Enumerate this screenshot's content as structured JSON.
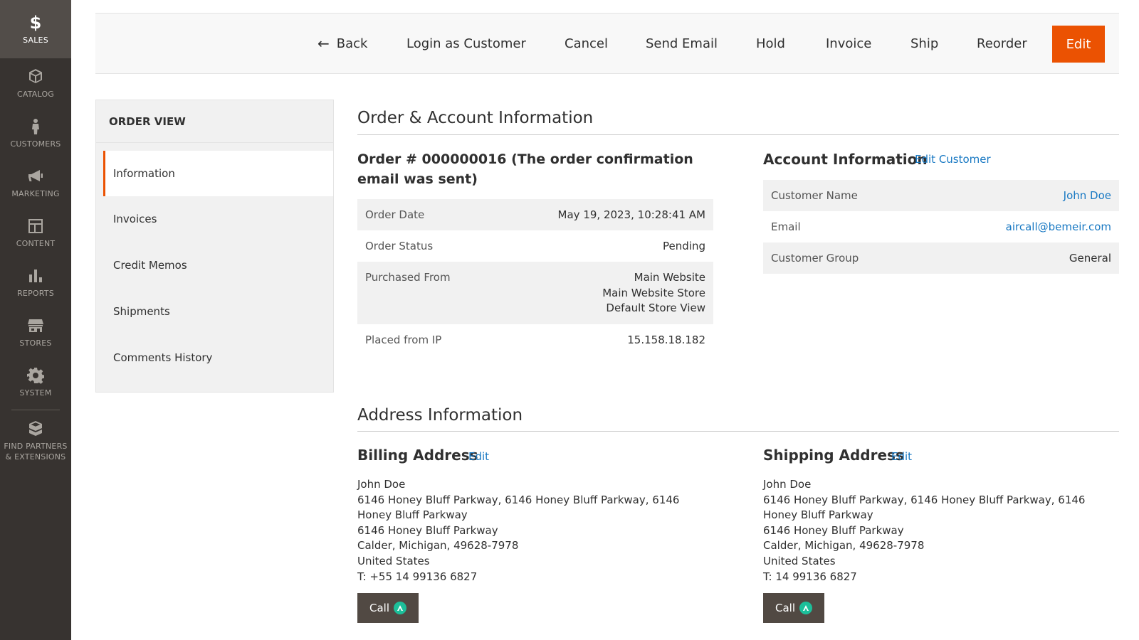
{
  "sidebar": {
    "items": [
      {
        "key": "sales",
        "label": "SALES",
        "icon": "dollar-icon",
        "active": true
      },
      {
        "key": "catalog",
        "label": "CATALOG",
        "icon": "cube-icon"
      },
      {
        "key": "customers",
        "label": "CUSTOMERS",
        "icon": "person-icon"
      },
      {
        "key": "marketing",
        "label": "MARKETING",
        "icon": "megaphone-icon"
      },
      {
        "key": "content",
        "label": "CONTENT",
        "icon": "layout-icon"
      },
      {
        "key": "reports",
        "label": "REPORTS",
        "icon": "bar-chart-icon"
      },
      {
        "key": "stores",
        "label": "STORES",
        "icon": "store-icon"
      },
      {
        "key": "system",
        "label": "SYSTEM",
        "icon": "gear-icon"
      },
      {
        "key": "partners",
        "label": "FIND PARTNERS\n& EXTENSIONS",
        "icon": "boxes-icon"
      }
    ]
  },
  "toolbar": {
    "back": "Back",
    "login_as_customer": "Login as Customer",
    "cancel": "Cancel",
    "send_email": "Send Email",
    "hold": "Hold",
    "invoice": "Invoice",
    "ship": "Ship",
    "reorder": "Reorder",
    "edit": "Edit",
    "accent_color": "#eb5202"
  },
  "order_view": {
    "title": "ORDER VIEW",
    "tabs": [
      {
        "label": "Information",
        "active": true
      },
      {
        "label": "Invoices"
      },
      {
        "label": "Credit Memos"
      },
      {
        "label": "Shipments"
      },
      {
        "label": "Comments History"
      }
    ]
  },
  "order_account": {
    "section_title": "Order & Account Information",
    "order_title": "Order # 000000016 (The order confirmation email was sent)",
    "order_rows": [
      {
        "label": "Order Date",
        "value": "May 19, 2023, 10:28:41 AM"
      },
      {
        "label": "Order Status",
        "value": "Pending"
      },
      {
        "label": "Purchased From",
        "value": [
          "Main Website",
          "Main Website Store",
          "Default Store View"
        ]
      },
      {
        "label": "Placed from IP",
        "value": "15.158.18.182"
      }
    ],
    "account_title": "Account Information",
    "edit_customer": "Edit Customer",
    "account_rows": [
      {
        "label": "Customer Name",
        "value": "John Doe"
      },
      {
        "label": "Email",
        "value": "aircall@bemeir.com"
      },
      {
        "label": "Customer Group",
        "value": "General"
      }
    ]
  },
  "address": {
    "section_title": "Address Information",
    "billing": {
      "title": "Billing Address",
      "edit": "Edit",
      "lines": [
        "John Doe",
        "6146 Honey Bluff Parkway, 6146 Honey Bluff Parkway, 6146 Honey Bluff Parkway",
        "6146 Honey Bluff Parkway",
        "Calder, Michigan, 49628-7978",
        "United States",
        "T: +55 14 99136 6827"
      ],
      "call": "Call"
    },
    "shipping": {
      "title": "Shipping Address",
      "edit": "Edit",
      "lines": [
        "John Doe",
        "6146 Honey Bluff Parkway, 6146 Honey Bluff Parkway, 6146 Honey Bluff Parkway",
        "6146 Honey Bluff Parkway",
        "Calder, Michigan, 49628-7978",
        "United States",
        "T: 14 99136 6827"
      ],
      "call": "Call"
    }
  }
}
